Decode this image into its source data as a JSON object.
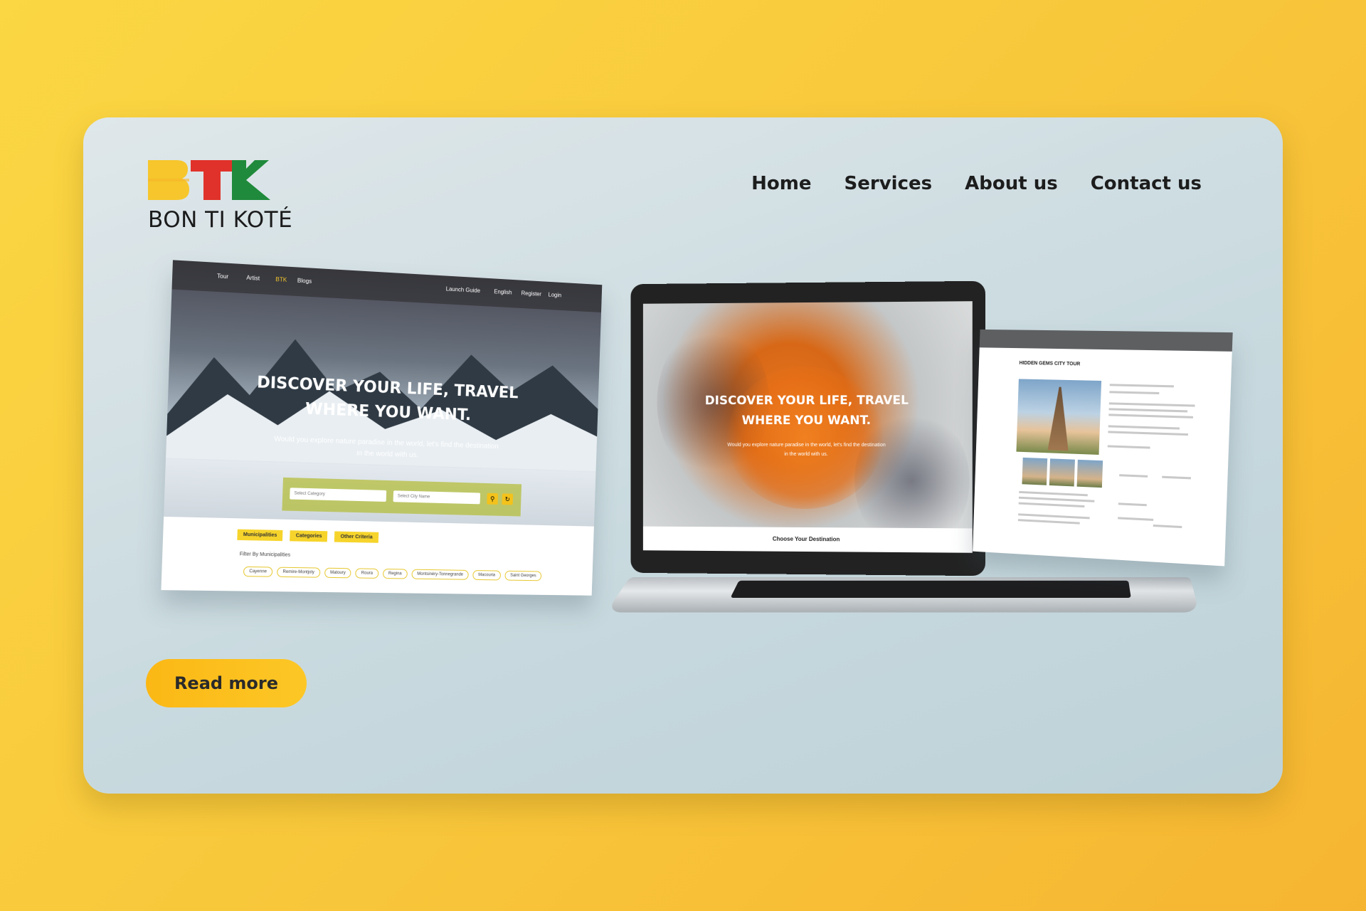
{
  "brand": {
    "name": "BON TI KOTÉ",
    "colors": {
      "yellow": "#f6c62c",
      "red": "#e0322a",
      "green": "#1f8a3b"
    }
  },
  "nav": {
    "items": [
      {
        "label": "Home"
      },
      {
        "label": "Services"
      },
      {
        "label": "About us"
      },
      {
        "label": "Contact us"
      }
    ]
  },
  "cta": {
    "label": "Read more"
  },
  "mockups": {
    "left": {
      "nav": [
        "Tour",
        "Artist",
        "BTK",
        "Blogs",
        "Launch Guide",
        "English",
        "Register",
        "Login"
      ],
      "hero_title_line1": "DISCOVER YOUR LIFE, TRAVEL",
      "hero_title_line2": "WHERE YOU WANT.",
      "hero_sub_line1": "Would you explore nature paradise in the world, let's find the destination",
      "hero_sub_line2": "in the world with us.",
      "search": {
        "category_placeholder": "Select Category",
        "city_placeholder": "Select City Name",
        "search_icon": "search-icon",
        "reset_icon": "refresh-icon"
      },
      "tabs": [
        "Municipalities",
        "Categories",
        "Other Criteria"
      ],
      "filter_label": "Filter By Municipalities",
      "chips": [
        "Cayenne",
        "Remire-Montjoly",
        "Matoury",
        "Roura",
        "Regina",
        "Montsinéry-Tonnegrande",
        "Macouria",
        "Saint Georges"
      ]
    },
    "laptop": {
      "hero_title_line1": "DISCOVER YOUR LIFE, TRAVEL",
      "hero_title_line2": "WHERE YOU WANT.",
      "hero_sub_line1": "Would you explore nature paradise in the world, let's find the destination",
      "hero_sub_line2": "in the world with us.",
      "bottom_bar": "Choose Your Destination"
    },
    "right": {
      "tour_title": "HIDDEN GEMS CITY TOUR"
    }
  }
}
